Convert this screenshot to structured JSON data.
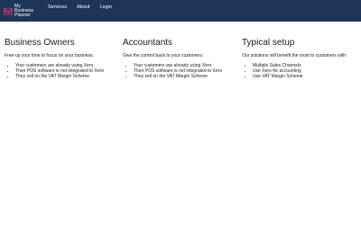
{
  "brand": {
    "name_line1": "My",
    "name_line2": "Business",
    "name_line3": "Planner",
    "logo_icon": "pink-geometric-logo-icon",
    "colors": {
      "navbar": "#1f3557",
      "logo_accent": "#e23a78"
    }
  },
  "nav": {
    "items": [
      {
        "label": "Services"
      },
      {
        "label": "About"
      },
      {
        "label": "Login"
      }
    ]
  },
  "columns": [
    {
      "heading": "Business Owners",
      "intro": "Free-up your time to focus on your business.",
      "bullets": [
        "Your customers are already using Xero",
        "Their POS software is not integrated to Xero",
        "They sell on the VAT Margin Scheme"
      ]
    },
    {
      "heading": "Accountants",
      "intro": "Give the control back to your customers.",
      "bullets": [
        "Your customers are already using Xero",
        "Their POS software is not integrated to Xero",
        "They sell on the VAT Margin Scheme"
      ]
    },
    {
      "heading": "Typical setup",
      "intro": "Our solutions will benefit the most to customers with:",
      "bullets": [
        "Multiple Sales Channels",
        "Use Xero for accounting",
        "Use VAT Margin Scheme"
      ]
    }
  ]
}
